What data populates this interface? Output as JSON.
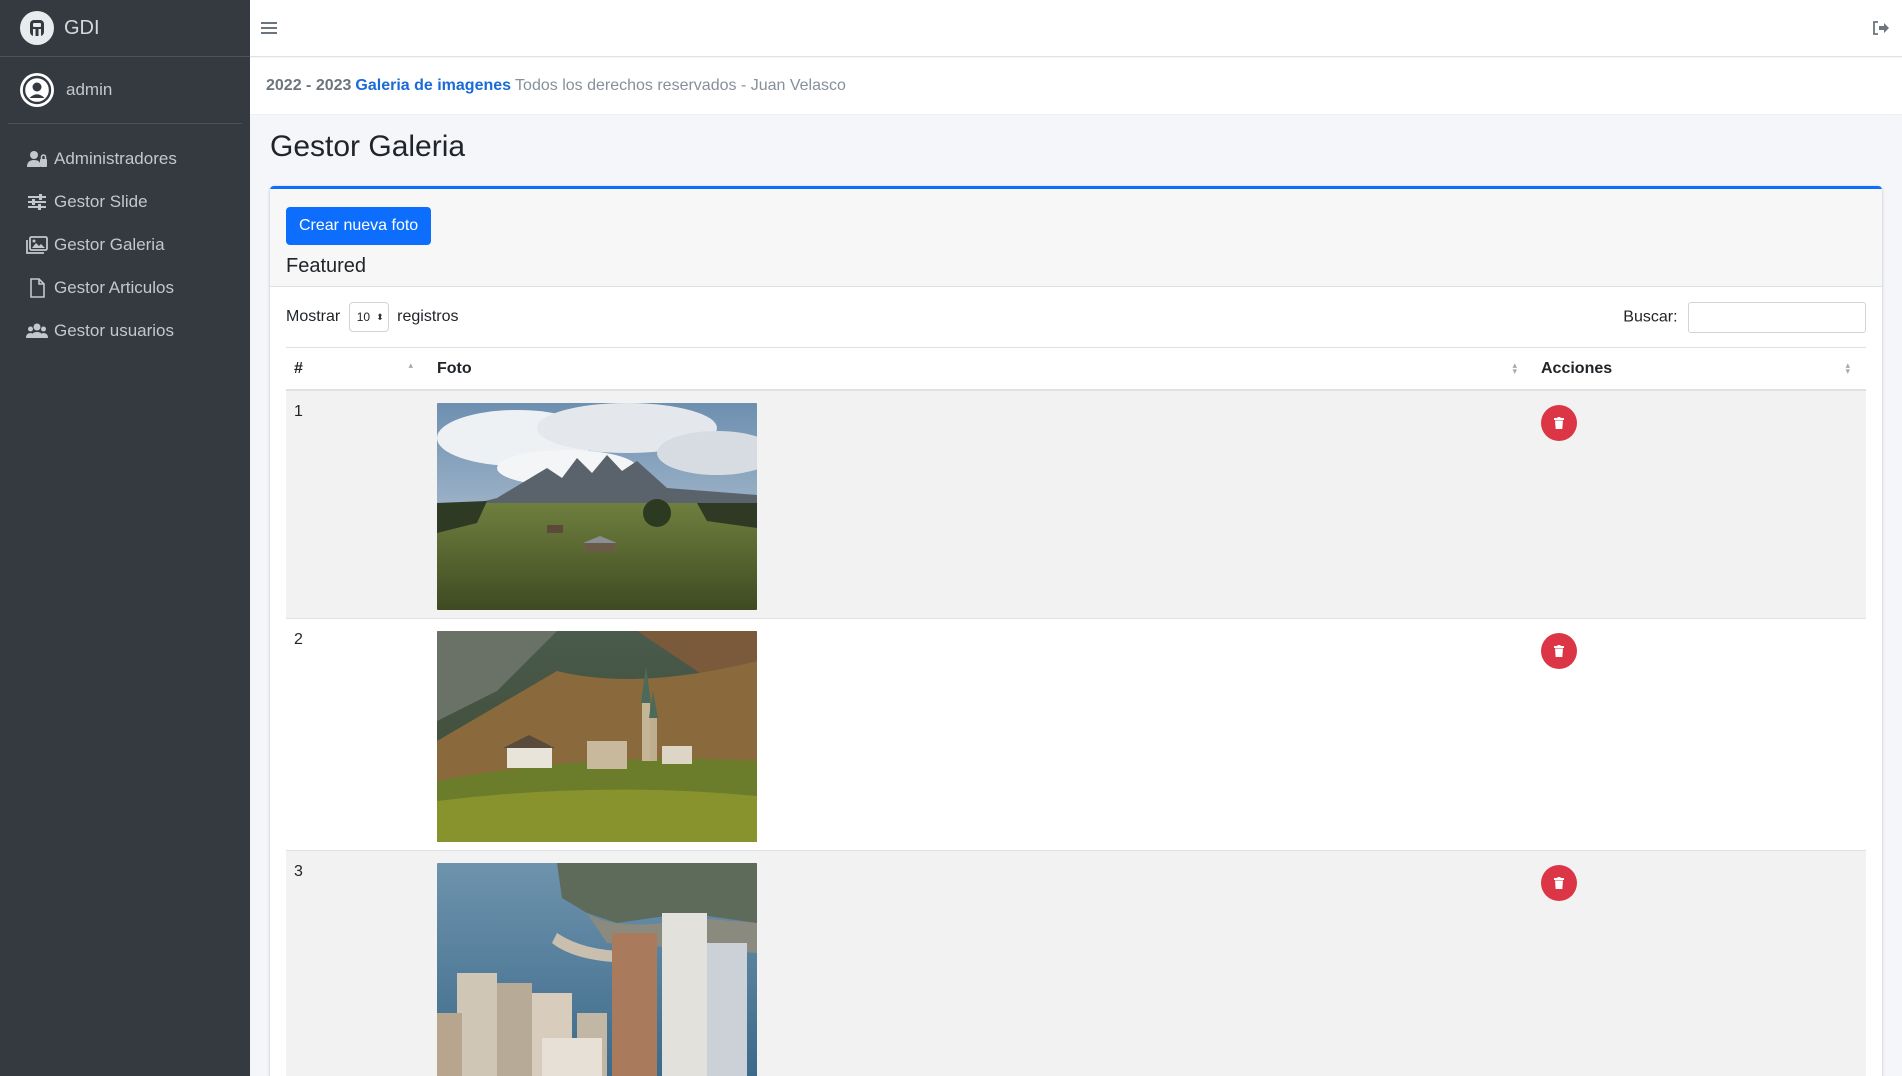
{
  "brand": {
    "name": "GDI"
  },
  "user": {
    "name": "admin"
  },
  "sidebar": {
    "items": [
      {
        "label": "Administradores",
        "icon": "users-cog-icon"
      },
      {
        "label": "Gestor Slide",
        "icon": "sliders-icon"
      },
      {
        "label": "Gestor Galeria",
        "icon": "images-icon"
      },
      {
        "label": "Gestor Articulos",
        "icon": "file-icon"
      },
      {
        "label": "Gestor usuarios",
        "icon": "users-icon"
      }
    ]
  },
  "footer": {
    "years": "2022 - 2023",
    "link": "Galeria de imagenes",
    "rights": "Todos los derechos reservados - Juan Velasco"
  },
  "page": {
    "title": "Gestor Galeria"
  },
  "card": {
    "create_button": "Crear nueva foto",
    "title": "Featured",
    "show_label": "Mostrar",
    "show_value": "10",
    "records_label": "registros",
    "search_label": "Buscar:"
  },
  "table": {
    "headers": {
      "num": "#",
      "foto": "Foto",
      "acciones": "Acciones"
    },
    "rows": [
      {
        "num": "1",
        "photo": "mountain-meadow"
      },
      {
        "num": "2",
        "photo": "church-valley"
      },
      {
        "num": "3",
        "photo": "coastal-city"
      }
    ]
  },
  "colors": {
    "sidebar": "#343a40",
    "primary": "#0d6efd",
    "danger": "#dc3545",
    "link": "#1a6ad8"
  }
}
